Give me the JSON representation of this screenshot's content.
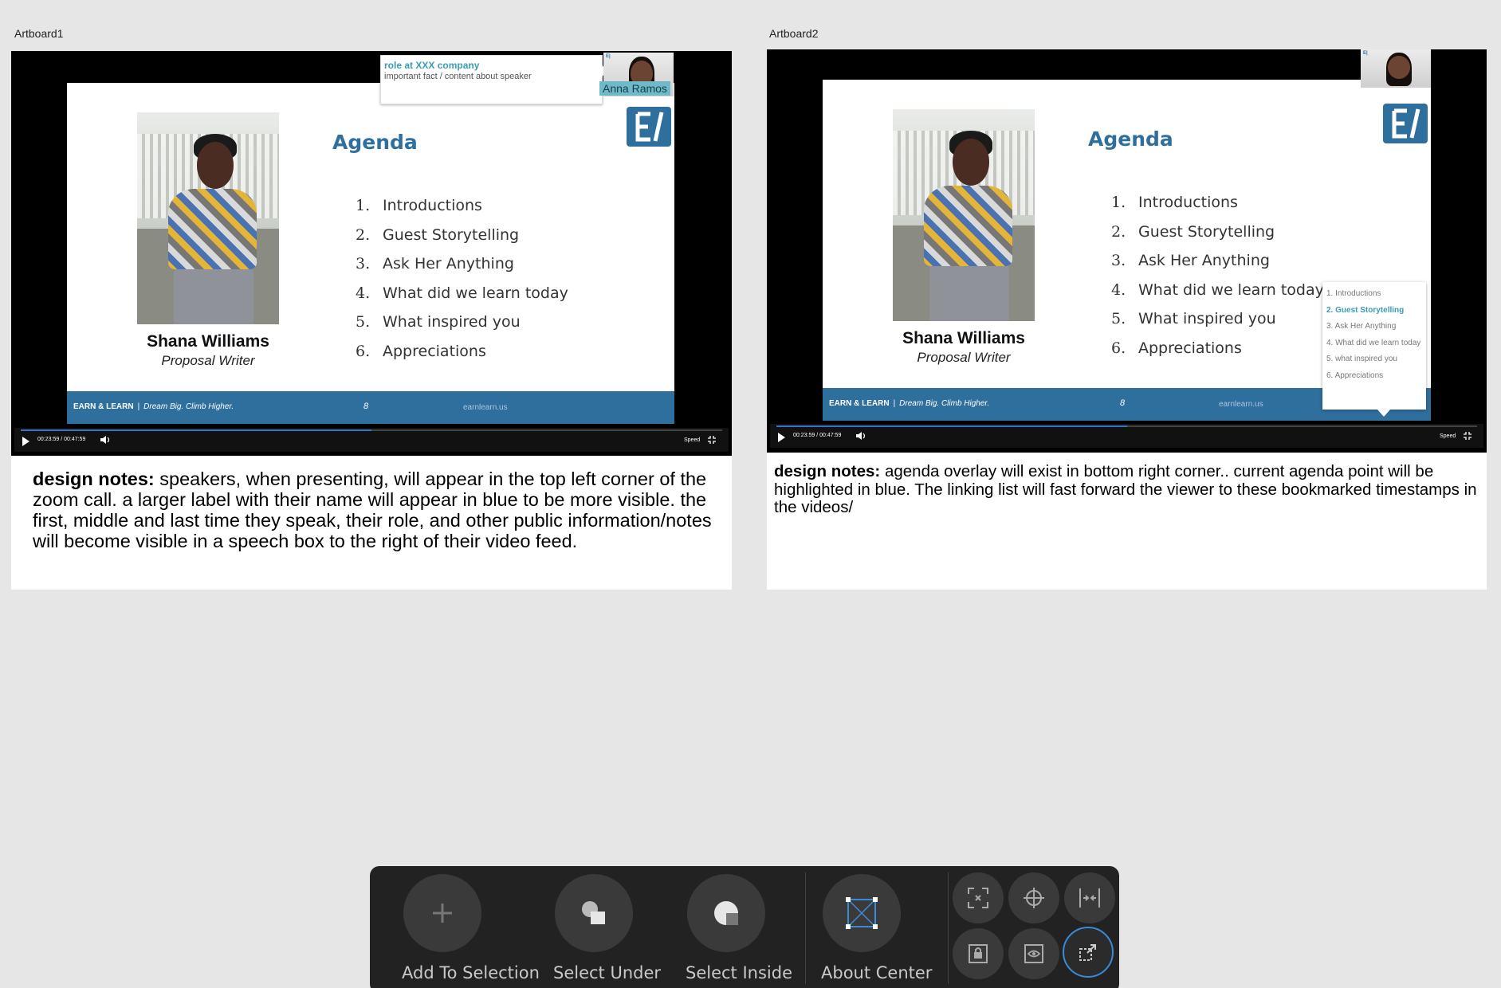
{
  "artboards": [
    {
      "label": "Artboard1",
      "speaker": {
        "name": "Shana Williams",
        "role": "Proposal Writer"
      },
      "agenda": {
        "title": "Agenda",
        "items": [
          {
            "num": "1.",
            "text": "Introductions"
          },
          {
            "num": "2.",
            "text": "Guest Storytelling"
          },
          {
            "num": "3.",
            "text": "Ask Her Anything"
          },
          {
            "num": "4.",
            "text": "What did we learn today"
          },
          {
            "num": "5.",
            "text": "What inspired you"
          },
          {
            "num": "6.",
            "text": "Appreciations"
          }
        ]
      },
      "footer": {
        "brand": "EARN & LEARN",
        "sep": "|",
        "tagline": "Dream Big. Climb Higher.",
        "page": "8",
        "url": "earnlearn.us"
      },
      "player": {
        "time": "00:23:59 / 00:47:59",
        "speed": "Speed",
        "progress": 0.5
      },
      "camera": {
        "badge": "E|",
        "name_label": "Anna Ramos"
      },
      "speech_box": {
        "title": "role at XXX company",
        "body": "important fact / content about speaker"
      },
      "notes": {
        "label": "design notes:",
        "text": " speakers, when presenting, will appear in the top left corner of the zoom call. a larger label with their name will appear in blue to be more visible. the first, middle and last time they speak, their role, and other public information/notes will become visible in a speech box to the right of their video feed."
      }
    },
    {
      "label": "Artboard2",
      "speaker": {
        "name": "Shana Williams",
        "role": "Proposal Writer"
      },
      "agenda": {
        "title": "Agenda",
        "items": [
          {
            "num": "1.",
            "text": "Introductions"
          },
          {
            "num": "2.",
            "text": "Guest Storytelling"
          },
          {
            "num": "3.",
            "text": "Ask Her Anything"
          },
          {
            "num": "4.",
            "text": "What did we learn today"
          },
          {
            "num": "5.",
            "text": "What inspired you"
          },
          {
            "num": "6.",
            "text": "Appreciations"
          }
        ]
      },
      "footer": {
        "brand": "EARN & LEARN",
        "sep": "|",
        "tagline": "Dream Big. Climb Higher.",
        "page": "8",
        "url": "earnlearn.us"
      },
      "player": {
        "time": "00:23:59 / 00:47:59",
        "speed": "Speed",
        "progress": 0.5
      },
      "camera": {
        "badge": "E|"
      },
      "overlay": {
        "items": [
          {
            "text": "1. Introductions",
            "active": false
          },
          {
            "text": "2. Guest Storytelling",
            "active": true
          },
          {
            "text": "3. Ask Her Anything",
            "active": false
          },
          {
            "text": "4. What did we learn today",
            "active": false
          },
          {
            "text": "5. what inspired you",
            "active": false
          },
          {
            "text": "6. Appreciations",
            "active": false
          }
        ]
      },
      "notes": {
        "label": "design notes:",
        "text": "  agenda overlay will exist in bottom right corner.. current agenda point will be highlighted in blue.  The linking list will fast forward the viewer to these bookmarked timestamps in the videos/"
      }
    }
  ],
  "toolbar": {
    "tools": [
      {
        "label": "Add To Selection",
        "icon": "plus-icon"
      },
      {
        "label": "Select Under",
        "icon": "select-under-icon"
      },
      {
        "label": "Select Inside",
        "icon": "select-inside-icon"
      },
      {
        "label": "About Center",
        "icon": "about-center-icon"
      }
    ],
    "mini_icons": [
      "focus-icon",
      "crosshair-icon",
      "distribute-icon",
      "lock-frame-icon",
      "eye-frame-icon",
      "transform-icon"
    ],
    "colors": {
      "accent": "#3a8ad6",
      "panel": "#222222"
    }
  }
}
